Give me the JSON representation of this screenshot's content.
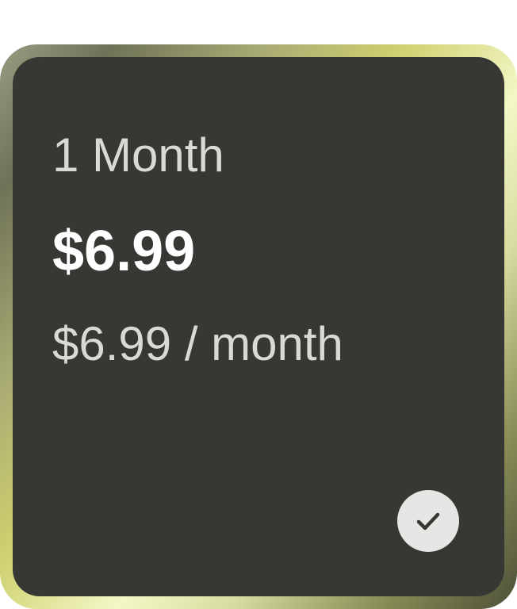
{
  "plan": {
    "name": "1 Month",
    "price": "$6.99",
    "per_period": "$6.99 / month",
    "selected": true,
    "icon": "check-icon"
  },
  "colors": {
    "card_background": "#373833",
    "primary_text": "#ffffff",
    "secondary_text": "#d9d9d6",
    "check_background": "#e6e6e4",
    "check_mark": "#373833"
  }
}
